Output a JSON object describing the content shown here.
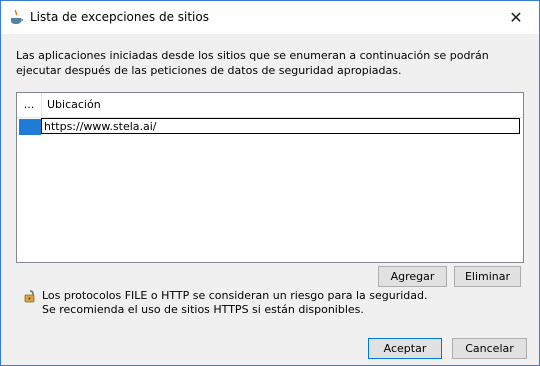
{
  "window": {
    "title": "Lista de excepciones de sitios",
    "close_glyph": "✕"
  },
  "description": "Las aplicaciones iniciadas desde los sitios que se enumeran a continuación se podrán ejecutar después de las peticiones de datos de seguridad apropiadas.",
  "table": {
    "columns": [
      "...",
      "Ubicación"
    ],
    "rows": [
      {
        "location": "https://www.stela.ai/"
      }
    ]
  },
  "buttons": {
    "add": "Agregar",
    "remove": "Eliminar",
    "accept": "Aceptar",
    "cancel": "Cancelar"
  },
  "warning": {
    "line1": "Los protocolos FILE o HTTP se consideran un riesgo para la seguridad.",
    "line2": "Se recomienda el uso de sitios HTTPS si están disponibles.",
    "icon": "lock-icon"
  },
  "colors": {
    "selection": "#1e7bd8",
    "lock": "#d9a441"
  }
}
